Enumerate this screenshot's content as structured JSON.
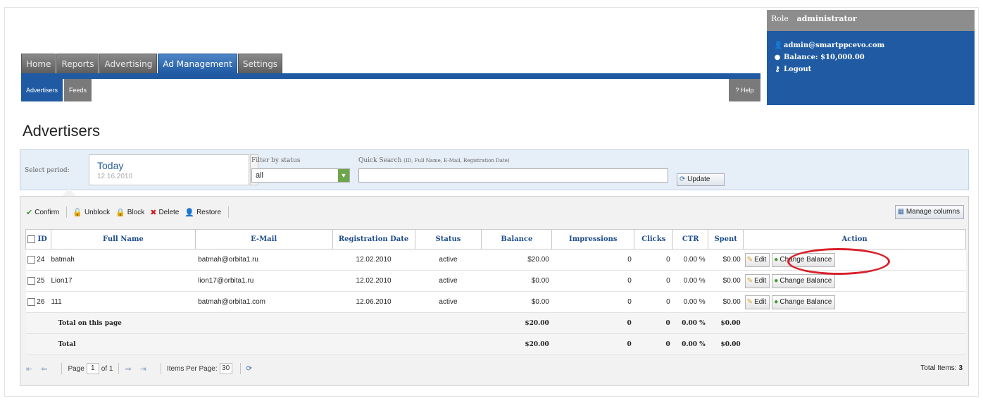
{
  "nav": {
    "main_tabs": [
      "Home",
      "Reports",
      "Advertising",
      "Ad Management",
      "Settings"
    ],
    "sub_tabs": [
      "Advertisers",
      "Feeds"
    ],
    "help": "Help"
  },
  "user": {
    "role_label": "Role",
    "role": "administrator",
    "email": "admin@smartppcevo.com",
    "balance": "Balance: $10,000.00",
    "logout": "Logout"
  },
  "page_title": "Advertisers",
  "filter": {
    "period_label": "Select period:",
    "period_value": "Today",
    "period_date": "12.16.2010",
    "status_label": "Filter by status",
    "status_value": "all",
    "search_label": "Quick Search",
    "search_hint": "(ID, Full Name, E-Mail, Registration Date)",
    "search_value": "",
    "update": "Update"
  },
  "toolbar": {
    "confirm": "Confirm",
    "unblock": "Unblock",
    "block": "Block",
    "delete": "Delete",
    "restore": "Restore",
    "manage_columns": "Manage columns"
  },
  "columns": [
    "ID",
    "Full Name",
    "E-Mail",
    "Registration Date",
    "Status",
    "Balance",
    "Impressions",
    "Clicks",
    "CTR",
    "Spent",
    "Action"
  ],
  "rows": [
    {
      "id": "24",
      "name": "batmah",
      "email": "batmah@orbita1.ru",
      "reg": "12.02.2010",
      "status": "active",
      "balance": "$20.00",
      "impressions": "0",
      "clicks": "0",
      "ctr": "0.00 %",
      "spent": "$0.00"
    },
    {
      "id": "25",
      "name": "Lion17",
      "email": "lion17@orbita1.ru",
      "reg": "12.02.2010",
      "status": "active",
      "balance": "$0.00",
      "impressions": "0",
      "clicks": "0",
      "ctr": "0.00 %",
      "spent": "$0.00"
    },
    {
      "id": "26",
      "name": "111",
      "email": "batmah@orbita1.com",
      "reg": "12.06.2010",
      "status": "active",
      "balance": "$0.00",
      "impressions": "0",
      "clicks": "0",
      "ctr": "0.00 %",
      "spent": "$0.00"
    }
  ],
  "actions": {
    "edit": "Edit",
    "change_balance": "Change Balance"
  },
  "totals": [
    {
      "label": "Total on this page",
      "balance": "$20.00",
      "impressions": "0",
      "clicks": "0",
      "ctr": "0.00 %",
      "spent": "$0.00"
    },
    {
      "label": "Total",
      "balance": "$20.00",
      "impressions": "0",
      "clicks": "0",
      "ctr": "0.00 %",
      "spent": "$0.00"
    }
  ],
  "pager": {
    "page_label": "Page",
    "page": "1",
    "of": "of 1",
    "per_page_label": "Items Per Page:",
    "per_page": "30",
    "total_label": "Total Items:",
    "total": "3"
  },
  "colors": {
    "nav_blue": "#1f5aa3",
    "highlight": "#d8202a"
  }
}
